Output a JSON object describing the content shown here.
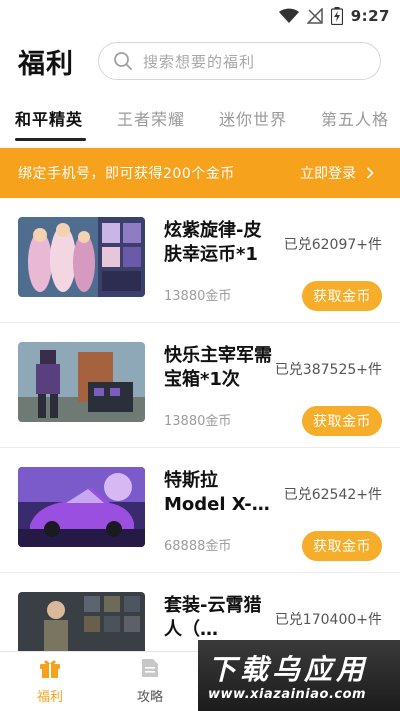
{
  "status_bar": {
    "time": "9:27"
  },
  "header": {
    "title": "福利",
    "search_placeholder": "搜索想要的福利"
  },
  "tabs": [
    {
      "label": "和平精英",
      "active": true
    },
    {
      "label": "王者荣耀",
      "active": false
    },
    {
      "label": "迷你世界",
      "active": false
    },
    {
      "label": "第五人格",
      "active": false
    }
  ],
  "banner": {
    "message": "绑定手机号，即可获得200个金币",
    "action": "立即登录"
  },
  "items": [
    {
      "title": "炫紫旋律-皮肤幸运币*1",
      "price": "13880金币",
      "redeemed": "已兑62097+件",
      "button": "获取金币"
    },
    {
      "title": "快乐主宰军需宝箱*1次",
      "price": "13880金币",
      "redeemed": "已兑387525+件",
      "button": "获取金币"
    },
    {
      "title": "特斯拉Model X-…",
      "price": "68888金币",
      "redeemed": "已兑62542+件",
      "button": "获取金币"
    },
    {
      "title": "套装-云霄猎人（…",
      "price": "",
      "redeemed": "已兑170400+件",
      "button": ""
    }
  ],
  "bottom_nav": [
    {
      "label": "福利",
      "icon": "gift-icon",
      "active": true
    },
    {
      "label": "攻略",
      "icon": "document-icon",
      "active": false
    }
  ],
  "watermark": {
    "text": "下载乌应用",
    "url": "www.xiazainiao.com"
  },
  "colors": {
    "accent": "#f7a21c",
    "button": "#f5ad2a"
  }
}
